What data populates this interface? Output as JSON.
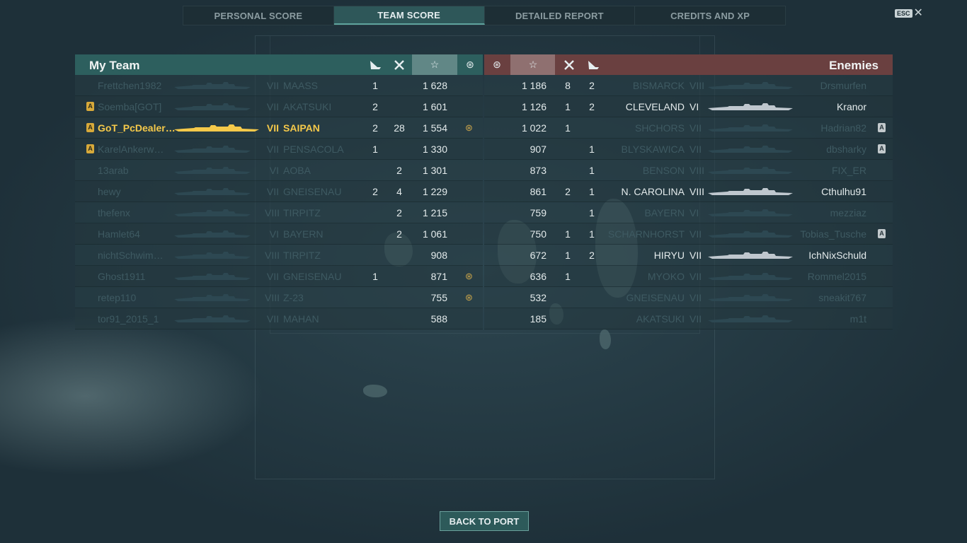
{
  "tabs": [
    {
      "label": "PERSONAL SCORE"
    },
    {
      "label": "TEAM SCORE"
    },
    {
      "label": "DETAILED REPORT"
    },
    {
      "label": "CREDITS AND XP"
    }
  ],
  "active_tab": "TEAM SCORE",
  "esc_label": "ESC",
  "my_team": {
    "title": "My Team",
    "header_icons": [
      "ship-kill-icon",
      "plane-kill-icon",
      "star-icon",
      "medal-icon"
    ],
    "rows": [
      {
        "player": "Frettchen1982",
        "tier": "VII",
        "ship": "MAASS",
        "ships_destroyed": "1",
        "planes_destroyed": "",
        "score": "1 628",
        "badge": false,
        "medal": false,
        "state": "dim"
      },
      {
        "player": "Soemba[GOT]",
        "tier": "VII",
        "ship": "AKATSUKI",
        "ships_destroyed": "2",
        "planes_destroyed": "",
        "score": "1 601",
        "badge": true,
        "medal": false,
        "state": "dim"
      },
      {
        "player": "GoT_PcDealer…",
        "tier": "VII",
        "ship": "SAIPAN",
        "ships_destroyed": "2",
        "planes_destroyed": "28",
        "score": "1 554",
        "badge": true,
        "medal": true,
        "state": "me"
      },
      {
        "player": "KarelAnkerw…",
        "tier": "VII",
        "ship": "PENSACOLA",
        "ships_destroyed": "1",
        "planes_destroyed": "",
        "score": "1 330",
        "badge": true,
        "medal": false,
        "state": "dim"
      },
      {
        "player": "13arab",
        "tier": "VI",
        "ship": "AOBA",
        "ships_destroyed": "",
        "planes_destroyed": "2",
        "score": "1 301",
        "badge": false,
        "medal": false,
        "state": "dim"
      },
      {
        "player": "hewy",
        "tier": "VII",
        "ship": "GNEISENAU",
        "ships_destroyed": "2",
        "planes_destroyed": "4",
        "score": "1 229",
        "badge": false,
        "medal": false,
        "state": "dim"
      },
      {
        "player": "thefenx",
        "tier": "VIII",
        "ship": "TIRPITZ",
        "ships_destroyed": "",
        "planes_destroyed": "2",
        "score": "1 215",
        "badge": false,
        "medal": false,
        "state": "dim"
      },
      {
        "player": "Hamlet64",
        "tier": "VI",
        "ship": "BAYERN",
        "ships_destroyed": "",
        "planes_destroyed": "2",
        "score": "1 061",
        "badge": false,
        "medal": false,
        "state": "dim"
      },
      {
        "player": "nichtSchwim…",
        "tier": "VIII",
        "ship": "TIRPITZ",
        "ships_destroyed": "",
        "planes_destroyed": "",
        "score": "908",
        "badge": false,
        "medal": false,
        "state": "dim"
      },
      {
        "player": "Ghost1911",
        "tier": "VII",
        "ship": "GNEISENAU",
        "ships_destroyed": "1",
        "planes_destroyed": "",
        "score": "871",
        "badge": false,
        "medal": true,
        "state": "dim"
      },
      {
        "player": "retep110",
        "tier": "VIII",
        "ship": "Z-23",
        "ships_destroyed": "",
        "planes_destroyed": "",
        "score": "755",
        "badge": false,
        "medal": true,
        "state": "dim"
      },
      {
        "player": "tor91_2015_1",
        "tier": "VII",
        "ship": "MAHAN",
        "ships_destroyed": "",
        "planes_destroyed": "",
        "score": "588",
        "badge": false,
        "medal": false,
        "state": "dim"
      }
    ]
  },
  "enemies": {
    "title": "Enemies",
    "header_icons": [
      "medal-icon",
      "star-icon",
      "plane-kill-icon",
      "ship-kill-icon"
    ],
    "rows": [
      {
        "player": "Drsmurfen",
        "tier": "VIII",
        "ship": "BISMARCK",
        "score": "1 186",
        "planes_destroyed": "8",
        "ships_destroyed": "2",
        "badge": false,
        "state": "dim"
      },
      {
        "player": "Kranor",
        "tier": "VI",
        "ship": "CLEVELAND",
        "score": "1 126",
        "planes_destroyed": "1",
        "ships_destroyed": "2",
        "badge": false,
        "state": "bright"
      },
      {
        "player": "Hadrian82",
        "tier": "VII",
        "ship": "SHCHORS",
        "score": "1 022",
        "planes_destroyed": "1",
        "ships_destroyed": "",
        "badge": true,
        "state": "dim"
      },
      {
        "player": "dbsharky",
        "tier": "VII",
        "ship": "BLYSKAWICA",
        "score": "907",
        "planes_destroyed": "",
        "ships_destroyed": "1",
        "badge": true,
        "state": "dim"
      },
      {
        "player": "FIX_ER",
        "tier": "VIII",
        "ship": "BENSON",
        "score": "873",
        "planes_destroyed": "",
        "ships_destroyed": "1",
        "badge": false,
        "state": "dim"
      },
      {
        "player": "Cthulhu91",
        "tier": "VIII",
        "ship": "N. CAROLINA",
        "score": "861",
        "planes_destroyed": "2",
        "ships_destroyed": "1",
        "badge": false,
        "state": "bright"
      },
      {
        "player": "mezziaz",
        "tier": "VI",
        "ship": "BAYERN",
        "score": "759",
        "planes_destroyed": "",
        "ships_destroyed": "1",
        "badge": false,
        "state": "dim"
      },
      {
        "player": "Tobias_Tusche",
        "tier": "VII",
        "ship": "SCHARNHORST",
        "score": "750",
        "planes_destroyed": "1",
        "ships_destroyed": "1",
        "badge": true,
        "state": "dim"
      },
      {
        "player": "IchNixSchuld",
        "tier": "VII",
        "ship": "HIRYU",
        "score": "672",
        "planes_destroyed": "1",
        "ships_destroyed": "2",
        "badge": false,
        "state": "bright"
      },
      {
        "player": "Rommel2015",
        "tier": "VII",
        "ship": "MYOKO",
        "score": "636",
        "planes_destroyed": "1",
        "ships_destroyed": "",
        "badge": false,
        "state": "dim"
      },
      {
        "player": "sneakit767",
        "tier": "VII",
        "ship": "GNEISENAU",
        "score": "532",
        "planes_destroyed": "",
        "ships_destroyed": "",
        "badge": false,
        "state": "dim"
      },
      {
        "player": "m1t",
        "tier": "VII",
        "ship": "AKATSUKI",
        "score": "185",
        "planes_destroyed": "",
        "ships_destroyed": "",
        "badge": false,
        "state": "dim"
      }
    ]
  },
  "back_button_label": "BACK TO PORT",
  "badge_letter": "A",
  "colors": {
    "my_team_header": "#2d5f5e",
    "enemy_header": "#6a4040",
    "highlight": "#f5c94a"
  }
}
